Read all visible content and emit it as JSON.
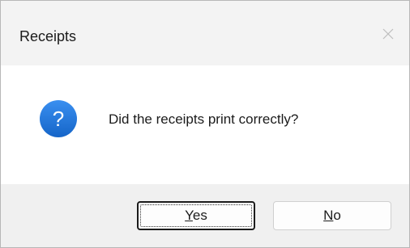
{
  "dialog": {
    "title": "Receipts",
    "close_icon": "close-icon",
    "message": "Did the receipts print correctly?",
    "icon": "question-icon",
    "icon_color": "#1a73d9"
  },
  "buttons": {
    "yes": {
      "mnemonic": "Y",
      "rest": "es"
    },
    "no": {
      "mnemonic": "N",
      "rest": "o"
    }
  }
}
